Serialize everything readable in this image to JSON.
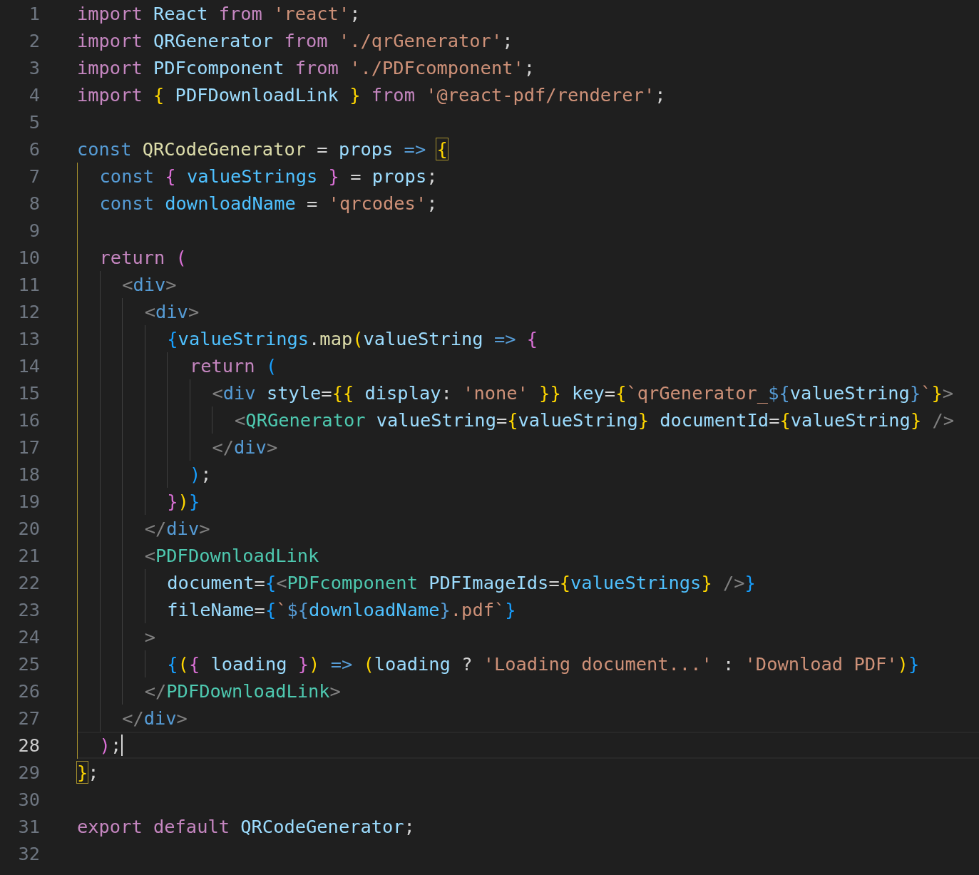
{
  "editor": {
    "lines": [
      {
        "number": "1",
        "current": false,
        "tokens": [
          {
            "text": "import",
            "kind": "kw"
          },
          {
            "text": " React ",
            "kind": "var"
          },
          {
            "text": "from",
            "kind": "kw"
          },
          {
            "text": " 'react'",
            "kind": "str"
          },
          {
            "text": ";",
            "kind": "punc"
          }
        ]
      },
      {
        "number": "2",
        "current": false,
        "tokens": [
          {
            "text": "import",
            "kind": "kw"
          },
          {
            "text": " QRGenerator ",
            "kind": "var"
          },
          {
            "text": "from",
            "kind": "kw"
          },
          {
            "text": " './qrGenerator'",
            "kind": "str"
          },
          {
            "text": ";",
            "kind": "punc"
          }
        ]
      },
      {
        "number": "3",
        "current": false,
        "tokens": [
          {
            "text": "import",
            "kind": "kw"
          },
          {
            "text": " PDFcomponent ",
            "kind": "var"
          },
          {
            "text": "from",
            "kind": "kw"
          },
          {
            "text": " './PDFcomponent'",
            "kind": "str"
          },
          {
            "text": ";",
            "kind": "punc"
          }
        ]
      },
      {
        "number": "4",
        "current": false,
        "tokens": [
          {
            "text": "import ",
            "kind": "kw"
          },
          {
            "text": "{",
            "kind": "b1"
          },
          {
            "text": " PDFDownloadLink ",
            "kind": "var"
          },
          {
            "text": "}",
            "kind": "b1"
          },
          {
            "text": " from",
            "kind": "kw"
          },
          {
            "text": " '@react-pdf/renderer'",
            "kind": "str"
          },
          {
            "text": ";",
            "kind": "punc"
          }
        ]
      },
      {
        "number": "5",
        "current": false
      },
      {
        "number": "6",
        "current": false,
        "tokens": [
          {
            "text": "const",
            "kind": "storage"
          },
          {
            "text": " QRCodeGenerator",
            "kind": "func"
          },
          {
            "text": " = ",
            "kind": "punc"
          },
          {
            "text": "props",
            "kind": "var"
          },
          {
            "text": " => ",
            "kind": "storage"
          },
          {
            "text": "{",
            "kind": "b1m"
          }
        ]
      },
      {
        "number": "7",
        "current": false,
        "tokens": [
          {
            "text": "  const ",
            "kind": "storage"
          },
          {
            "text": "{",
            "kind": "b2"
          },
          {
            "text": " valueStrings ",
            "kind": "const"
          },
          {
            "text": "}",
            "kind": "b2"
          },
          {
            "text": " = ",
            "kind": "punc"
          },
          {
            "text": "props",
            "kind": "var"
          },
          {
            "text": ";",
            "kind": "punc"
          }
        ]
      },
      {
        "number": "8",
        "current": false,
        "tokens": [
          {
            "text": "  const ",
            "kind": "storage"
          },
          {
            "text": "downloadName",
            "kind": "const"
          },
          {
            "text": " = ",
            "kind": "punc"
          },
          {
            "text": "'qrcodes'",
            "kind": "str"
          },
          {
            "text": ";",
            "kind": "punc"
          }
        ]
      },
      {
        "number": "9",
        "current": false
      },
      {
        "number": "10",
        "current": false,
        "tokens": [
          {
            "text": "  return ",
            "kind": "kw"
          },
          {
            "text": "(",
            "kind": "b2"
          }
        ]
      },
      {
        "number": "11",
        "current": false,
        "tokens": [
          {
            "text": "    <",
            "kind": "angle"
          },
          {
            "text": "div",
            "kind": "tag"
          },
          {
            "text": ">",
            "kind": "angle"
          }
        ]
      },
      {
        "number": "12",
        "current": false,
        "tokens": [
          {
            "text": "      <",
            "kind": "angle"
          },
          {
            "text": "div",
            "kind": "tag"
          },
          {
            "text": ">",
            "kind": "angle"
          }
        ]
      },
      {
        "number": "13",
        "current": false,
        "tokens": [
          {
            "text": "        {",
            "kind": "b3"
          },
          {
            "text": "valueStrings",
            "kind": "const"
          },
          {
            "text": ".",
            "kind": "punc"
          },
          {
            "text": "map",
            "kind": "func"
          },
          {
            "text": "(",
            "kind": "b1"
          },
          {
            "text": "valueString",
            "kind": "var"
          },
          {
            "text": " => ",
            "kind": "storage"
          },
          {
            "text": "{",
            "kind": "b2"
          }
        ]
      },
      {
        "number": "14",
        "current": false,
        "tokens": [
          {
            "text": "          return ",
            "kind": "kw"
          },
          {
            "text": "(",
            "kind": "b3"
          }
        ]
      },
      {
        "number": "15",
        "current": false,
        "tokens": [
          {
            "text": "            <",
            "kind": "angle"
          },
          {
            "text": "div",
            "kind": "tag"
          },
          {
            "text": " style",
            "kind": "attr"
          },
          {
            "text": "=",
            "kind": "punc"
          },
          {
            "text": "{{",
            "kind": "b1"
          },
          {
            "text": " display",
            "kind": "attr"
          },
          {
            "text": ": ",
            "kind": "punc"
          },
          {
            "text": "'none'",
            "kind": "str"
          },
          {
            "text": " }}",
            "kind": "b1"
          },
          {
            "text": " key",
            "kind": "attr"
          },
          {
            "text": "=",
            "kind": "punc"
          },
          {
            "text": "{",
            "kind": "b1"
          },
          {
            "text": "`qrGenerator_",
            "kind": "str"
          },
          {
            "text": "${",
            "kind": "storage"
          },
          {
            "text": "valueString",
            "kind": "var"
          },
          {
            "text": "}",
            "kind": "storage"
          },
          {
            "text": "`",
            "kind": "str"
          },
          {
            "text": "}",
            "kind": "b1"
          },
          {
            "text": ">",
            "kind": "angle"
          }
        ]
      },
      {
        "number": "16",
        "current": false,
        "tokens": [
          {
            "text": "              <",
            "kind": "angle"
          },
          {
            "text": "QRGenerator",
            "kind": "comp"
          },
          {
            "text": " valueString",
            "kind": "attr"
          },
          {
            "text": "=",
            "kind": "punc"
          },
          {
            "text": "{",
            "kind": "b1"
          },
          {
            "text": "valueString",
            "kind": "var"
          },
          {
            "text": "}",
            "kind": "b1"
          },
          {
            "text": " documentId",
            "kind": "attr"
          },
          {
            "text": "=",
            "kind": "punc"
          },
          {
            "text": "{",
            "kind": "b1"
          },
          {
            "text": "valueString",
            "kind": "var"
          },
          {
            "text": "}",
            "kind": "b1"
          },
          {
            "text": " />",
            "kind": "angle"
          }
        ]
      },
      {
        "number": "17",
        "current": false,
        "tokens": [
          {
            "text": "            </",
            "kind": "angle"
          },
          {
            "text": "div",
            "kind": "tag"
          },
          {
            "text": ">",
            "kind": "angle"
          }
        ]
      },
      {
        "number": "18",
        "current": false,
        "tokens": [
          {
            "text": "          )",
            "kind": "b3"
          },
          {
            "text": ";",
            "kind": "punc"
          }
        ]
      },
      {
        "number": "19",
        "current": false,
        "tokens": [
          {
            "text": "        }",
            "kind": "b2"
          },
          {
            "text": ")",
            "kind": "b1"
          },
          {
            "text": "}",
            "kind": "b3"
          }
        ]
      },
      {
        "number": "20",
        "current": false,
        "tokens": [
          {
            "text": "      </",
            "kind": "angle"
          },
          {
            "text": "div",
            "kind": "tag"
          },
          {
            "text": ">",
            "kind": "angle"
          }
        ]
      },
      {
        "number": "21",
        "current": false,
        "tokens": [
          {
            "text": "      <",
            "kind": "angle"
          },
          {
            "text": "PDFDownloadLink",
            "kind": "comp"
          }
        ]
      },
      {
        "number": "22",
        "current": false,
        "tokens": [
          {
            "text": "        document",
            "kind": "attr"
          },
          {
            "text": "=",
            "kind": "punc"
          },
          {
            "text": "{",
            "kind": "b3"
          },
          {
            "text": "<",
            "kind": "angle"
          },
          {
            "text": "PDFcomponent",
            "kind": "comp"
          },
          {
            "text": " PDFImageIds",
            "kind": "attr"
          },
          {
            "text": "=",
            "kind": "punc"
          },
          {
            "text": "{",
            "kind": "b1"
          },
          {
            "text": "valueStrings",
            "kind": "const"
          },
          {
            "text": "}",
            "kind": "b1"
          },
          {
            "text": " />",
            "kind": "angle"
          },
          {
            "text": "}",
            "kind": "b3"
          }
        ]
      },
      {
        "number": "23",
        "current": false,
        "tokens": [
          {
            "text": "        fileName",
            "kind": "attr"
          },
          {
            "text": "=",
            "kind": "punc"
          },
          {
            "text": "{",
            "kind": "b3"
          },
          {
            "text": "`",
            "kind": "str"
          },
          {
            "text": "${",
            "kind": "storage"
          },
          {
            "text": "downloadName",
            "kind": "const"
          },
          {
            "text": "}",
            "kind": "storage"
          },
          {
            "text": ".pdf`",
            "kind": "str"
          },
          {
            "text": "}",
            "kind": "b3"
          }
        ]
      },
      {
        "number": "24",
        "current": false,
        "tokens": [
          {
            "text": "      >",
            "kind": "angle"
          }
        ]
      },
      {
        "number": "25",
        "current": false,
        "tokens": [
          {
            "text": "        {",
            "kind": "b3"
          },
          {
            "text": "(",
            "kind": "b1"
          },
          {
            "text": "{",
            "kind": "b2"
          },
          {
            "text": " loading ",
            "kind": "var"
          },
          {
            "text": "}",
            "kind": "b2"
          },
          {
            "text": ")",
            "kind": "b1"
          },
          {
            "text": " => ",
            "kind": "storage"
          },
          {
            "text": "(",
            "kind": "b1"
          },
          {
            "text": "loading",
            "kind": "var"
          },
          {
            "text": " ? ",
            "kind": "punc"
          },
          {
            "text": "'Loading document...'",
            "kind": "str"
          },
          {
            "text": " : ",
            "kind": "punc"
          },
          {
            "text": "'Download PDF'",
            "kind": "str"
          },
          {
            "text": ")",
            "kind": "b1"
          },
          {
            "text": "}",
            "kind": "b3"
          }
        ]
      },
      {
        "number": "26",
        "current": false,
        "tokens": [
          {
            "text": "      </",
            "kind": "angle"
          },
          {
            "text": "PDFDownloadLink",
            "kind": "comp"
          },
          {
            "text": ">",
            "kind": "angle"
          }
        ]
      },
      {
        "number": "27",
        "current": false,
        "tokens": [
          {
            "text": "    </",
            "kind": "angle"
          },
          {
            "text": "div",
            "kind": "tag"
          },
          {
            "text": ">",
            "kind": "angle"
          }
        ]
      },
      {
        "number": "28",
        "current": true,
        "tokens": [
          {
            "text": "  )",
            "kind": "b2"
          },
          {
            "text": ";",
            "kind": "punc"
          }
        ]
      },
      {
        "number": "29",
        "current": false,
        "tokens": [
          {
            "text": "}",
            "kind": "b1m"
          },
          {
            "text": ";",
            "kind": "punc"
          }
        ]
      },
      {
        "number": "30",
        "current": false
      },
      {
        "number": "31",
        "current": false,
        "tokens": [
          {
            "text": "export default",
            "kind": "kw"
          },
          {
            "text": " QRCodeGenerator",
            "kind": "var"
          },
          {
            "text": ";",
            "kind": "punc"
          }
        ]
      },
      {
        "number": "32",
        "current": false
      }
    ]
  }
}
